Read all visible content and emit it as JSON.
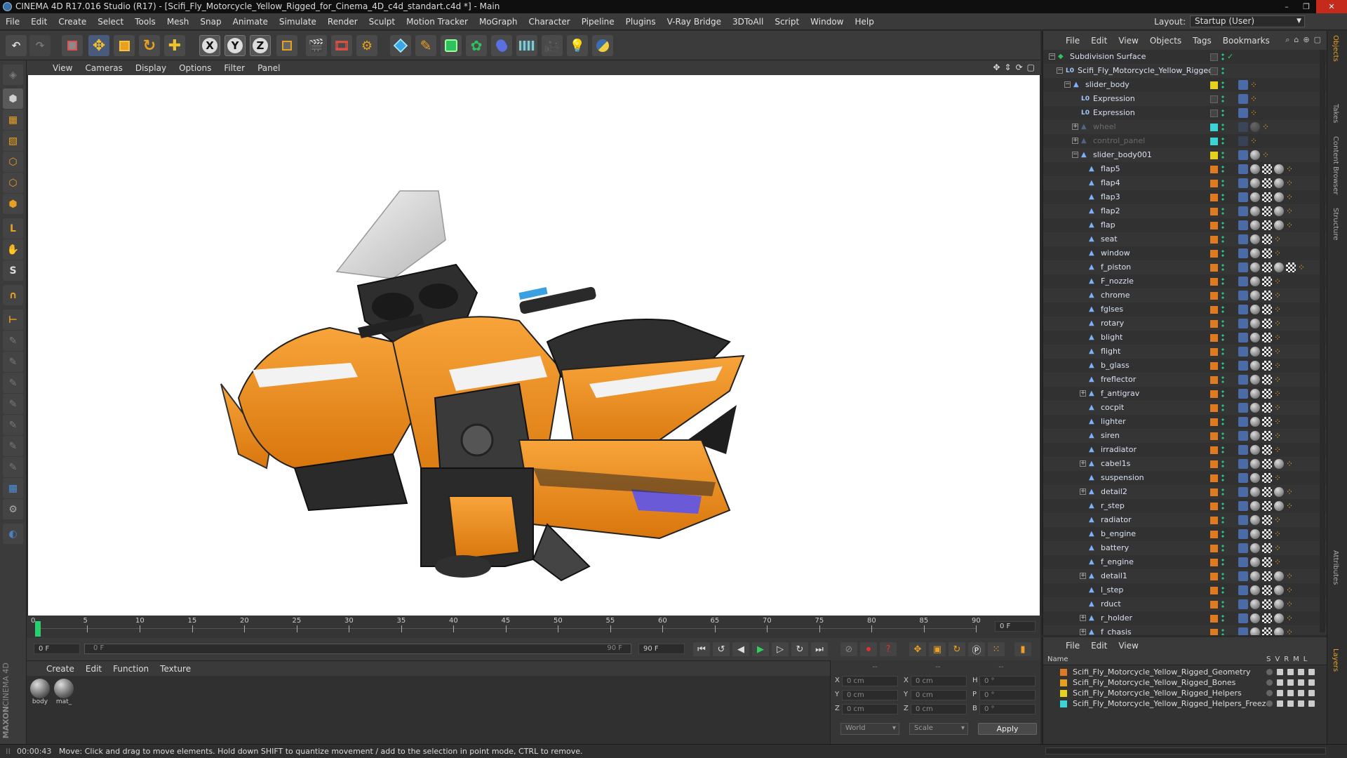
{
  "window": {
    "title": "CINEMA 4D R17.016 Studio (R17) - [Scifi_Fly_Motorcycle_Yellow_Rigged_for_Cinema_4D_c4d_standart.c4d *] - Main",
    "controls": [
      "–",
      "❐",
      "✕"
    ]
  },
  "menubar": {
    "items": [
      "File",
      "Edit",
      "Create",
      "Select",
      "Tools",
      "Mesh",
      "Snap",
      "Animate",
      "Simulate",
      "Render",
      "Sculpt",
      "Motion Tracker",
      "MoGraph",
      "Character",
      "Pipeline",
      "Plugins",
      "V-Ray Bridge",
      "3DToAll",
      "Script",
      "Window",
      "Help"
    ],
    "layout_label": "Layout:",
    "layout_value": "Startup (User)"
  },
  "toolbar": {
    "axis_x": "X",
    "axis_y": "Y",
    "axis_z": "Z"
  },
  "viewport": {
    "menu": [
      "View",
      "Cameras",
      "Display",
      "Options",
      "Filter",
      "Panel"
    ]
  },
  "timeline": {
    "ticks": [
      "0",
      "5",
      "10",
      "15",
      "20",
      "25",
      "30",
      "35",
      "40",
      "45",
      "50",
      "55",
      "60",
      "65",
      "70",
      "75",
      "80",
      "85",
      "90"
    ],
    "current_frame": "0 F",
    "start_field": "0 F",
    "range_start": "0 F",
    "range_end": "90 F",
    "end_field": "90 F"
  },
  "material_manager": {
    "menu": [
      "Create",
      "Edit",
      "Function",
      "Texture"
    ],
    "materials": [
      {
        "label": "body"
      },
      {
        "label": "mat_"
      }
    ]
  },
  "coordinates": {
    "header": [
      "--",
      "--",
      "--"
    ],
    "rows": [
      {
        "a": "X",
        "a_val": "0 cm",
        "b": "X",
        "b_val": "0 cm",
        "c": "H",
        "c_val": "0 °"
      },
      {
        "a": "Y",
        "a_val": "0 cm",
        "b": "Y",
        "b_val": "0 cm",
        "c": "P",
        "c_val": "0 °"
      },
      {
        "a": "Z",
        "a_val": "0 cm",
        "b": "Z",
        "b_val": "0 cm",
        "c": "B",
        "c_val": "0 °"
      }
    ],
    "space": "World",
    "mode": "Scale",
    "apply": "Apply"
  },
  "object_manager": {
    "menu": [
      "File",
      "Edit",
      "View",
      "Objects",
      "Tags",
      "Bookmarks"
    ],
    "rows": [
      {
        "name": "Subdivision Surface",
        "indent": 0,
        "expander": "−",
        "type": "subdiv",
        "dim": false,
        "swatch": "",
        "check": true,
        "tags": 0
      },
      {
        "name": "Scifi_Fly_Motorcycle_Yellow_Rigged",
        "indent": 1,
        "expander": "−",
        "type": "null",
        "dim": false,
        "swatch": "",
        "tags": 0
      },
      {
        "name": "slider_body",
        "indent": 2,
        "expander": "−",
        "type": "bone",
        "dim": false,
        "swatch": "#e6d21a",
        "tags": 1
      },
      {
        "name": "Expression",
        "indent": 3,
        "expander": "",
        "type": "null",
        "dim": false,
        "swatch": "",
        "tags": 1
      },
      {
        "name": "Expression",
        "indent": 3,
        "expander": "",
        "type": "null",
        "dim": false,
        "swatch": "",
        "tags": 1
      },
      {
        "name": "wheel",
        "indent": 3,
        "expander": "+",
        "type": "bone",
        "dim": true,
        "swatch": "#3ad4d4",
        "tags": 2
      },
      {
        "name": "control_panel",
        "indent": 3,
        "expander": "+",
        "type": "bone",
        "dim": true,
        "swatch": "#3ad4d4",
        "tags": 1
      },
      {
        "name": "slider_body001",
        "indent": 3,
        "expander": "−",
        "type": "bone",
        "dim": false,
        "swatch": "#e6d21a",
        "tags": 2
      },
      {
        "name": "flap5",
        "indent": 4,
        "expander": "",
        "type": "bone",
        "dim": false,
        "swatch": "#e07a20",
        "tags": 4
      },
      {
        "name": "flap4",
        "indent": 4,
        "expander": "",
        "type": "bone",
        "dim": false,
        "swatch": "#e07a20",
        "tags": 4
      },
      {
        "name": "flap3",
        "indent": 4,
        "expander": "",
        "type": "bone",
        "dim": false,
        "swatch": "#e07a20",
        "tags": 4
      },
      {
        "name": "flap2",
        "indent": 4,
        "expander": "",
        "type": "bone",
        "dim": false,
        "swatch": "#e07a20",
        "tags": 4
      },
      {
        "name": "flap",
        "indent": 4,
        "expander": "",
        "type": "bone",
        "dim": false,
        "swatch": "#e07a20",
        "tags": 4
      },
      {
        "name": "seat",
        "indent": 4,
        "expander": "",
        "type": "bone",
        "dim": false,
        "swatch": "#e07a20",
        "tags": 3
      },
      {
        "name": "window",
        "indent": 4,
        "expander": "",
        "type": "bone",
        "dim": false,
        "swatch": "#e07a20",
        "tags": 3
      },
      {
        "name": "f_piston",
        "indent": 4,
        "expander": "",
        "type": "bone",
        "dim": false,
        "swatch": "#e07a20",
        "tags": 5
      },
      {
        "name": "F_nozzle",
        "indent": 4,
        "expander": "",
        "type": "bone",
        "dim": false,
        "swatch": "#e07a20",
        "tags": 3
      },
      {
        "name": "chrome",
        "indent": 4,
        "expander": "",
        "type": "bone",
        "dim": false,
        "swatch": "#e07a20",
        "tags": 3
      },
      {
        "name": "fglses",
        "indent": 4,
        "expander": "",
        "type": "bone",
        "dim": false,
        "swatch": "#e07a20",
        "tags": 3
      },
      {
        "name": "rotary",
        "indent": 4,
        "expander": "",
        "type": "bone",
        "dim": false,
        "swatch": "#e07a20",
        "tags": 3
      },
      {
        "name": "blight",
        "indent": 4,
        "expander": "",
        "type": "bone",
        "dim": false,
        "swatch": "#e07a20",
        "tags": 3
      },
      {
        "name": "flight",
        "indent": 4,
        "expander": "",
        "type": "bone",
        "dim": false,
        "swatch": "#e07a20",
        "tags": 3
      },
      {
        "name": "b_glass",
        "indent": 4,
        "expander": "",
        "type": "bone",
        "dim": false,
        "swatch": "#e07a20",
        "tags": 3
      },
      {
        "name": "freflector",
        "indent": 4,
        "expander": "",
        "type": "bone",
        "dim": false,
        "swatch": "#e07a20",
        "tags": 3
      },
      {
        "name": "f_antigrav",
        "indent": 4,
        "expander": "+",
        "type": "bone",
        "dim": false,
        "swatch": "#e07a20",
        "tags": 3
      },
      {
        "name": "cocpit",
        "indent": 4,
        "expander": "",
        "type": "bone",
        "dim": false,
        "swatch": "#e07a20",
        "tags": 3
      },
      {
        "name": "lighter",
        "indent": 4,
        "expander": "",
        "type": "bone",
        "dim": false,
        "swatch": "#e07a20",
        "tags": 3
      },
      {
        "name": "siren",
        "indent": 4,
        "expander": "",
        "type": "bone",
        "dim": false,
        "swatch": "#e07a20",
        "tags": 3
      },
      {
        "name": "irradiator",
        "indent": 4,
        "expander": "",
        "type": "bone",
        "dim": false,
        "swatch": "#e07a20",
        "tags": 3
      },
      {
        "name": "cabel1s",
        "indent": 4,
        "expander": "+",
        "type": "bone",
        "dim": false,
        "swatch": "#e07a20",
        "tags": 4
      },
      {
        "name": "suspension",
        "indent": 4,
        "expander": "",
        "type": "bone",
        "dim": false,
        "swatch": "#e07a20",
        "tags": 3
      },
      {
        "name": "detail2",
        "indent": 4,
        "expander": "+",
        "type": "bone",
        "dim": false,
        "swatch": "#e07a20",
        "tags": 4
      },
      {
        "name": "r_step",
        "indent": 4,
        "expander": "",
        "type": "bone",
        "dim": false,
        "swatch": "#e07a20",
        "tags": 4
      },
      {
        "name": "radiator",
        "indent": 4,
        "expander": "",
        "type": "bone",
        "dim": false,
        "swatch": "#e07a20",
        "tags": 3
      },
      {
        "name": "b_engine",
        "indent": 4,
        "expander": "",
        "type": "bone",
        "dim": false,
        "swatch": "#e07a20",
        "tags": 3
      },
      {
        "name": "battery",
        "indent": 4,
        "expander": "",
        "type": "bone",
        "dim": false,
        "swatch": "#e07a20",
        "tags": 3
      },
      {
        "name": "f_engine",
        "indent": 4,
        "expander": "",
        "type": "bone",
        "dim": false,
        "swatch": "#e07a20",
        "tags": 3
      },
      {
        "name": "detail1",
        "indent": 4,
        "expander": "+",
        "type": "bone",
        "dim": false,
        "swatch": "#e07a20",
        "tags": 4
      },
      {
        "name": "l_step",
        "indent": 4,
        "expander": "",
        "type": "bone",
        "dim": false,
        "swatch": "#e07a20",
        "tags": 4
      },
      {
        "name": "rduct",
        "indent": 4,
        "expander": "",
        "type": "bone",
        "dim": false,
        "swatch": "#e07a20",
        "tags": 4
      },
      {
        "name": "r_holder",
        "indent": 4,
        "expander": "+",
        "type": "bone",
        "dim": false,
        "swatch": "#e07a20",
        "tags": 4
      },
      {
        "name": "f_chasis",
        "indent": 4,
        "expander": "+",
        "type": "bone",
        "dim": false,
        "swatch": "#e07a20",
        "tags": 4
      }
    ]
  },
  "layer_manager": {
    "menu": [
      "File",
      "Edit",
      "View"
    ],
    "columns": {
      "name": "Name",
      "flags": [
        "S",
        "V",
        "R",
        "M",
        "L"
      ]
    },
    "layers": [
      {
        "name": "Scifi_Fly_Motorcycle_Yellow_Rigged_Geometry",
        "color": "#e07a20"
      },
      {
        "name": "Scifi_Fly_Motorcycle_Yellow_Rigged_Bones",
        "color": "#e6a020"
      },
      {
        "name": "Scifi_Fly_Motorcycle_Yellow_Rigged_Helpers",
        "color": "#e6d21a"
      },
      {
        "name": "Scifi_Fly_Motorcycle_Yellow_Rigged_Helpers_Freeze",
        "color": "#3ad4d4"
      }
    ]
  },
  "side_tabs": [
    "Objects",
    "Takes",
    "Content Browser",
    "Structure",
    "Attributes",
    "Layers"
  ],
  "branding": {
    "line1": "MAXON",
    "line2": "CINEMA 4D"
  },
  "statusbar": {
    "time": "00:00:43",
    "message": "Move: Click and drag to move elements. Hold down SHIFT to quantize movement / add to the selection in point mode, CTRL to remove."
  }
}
